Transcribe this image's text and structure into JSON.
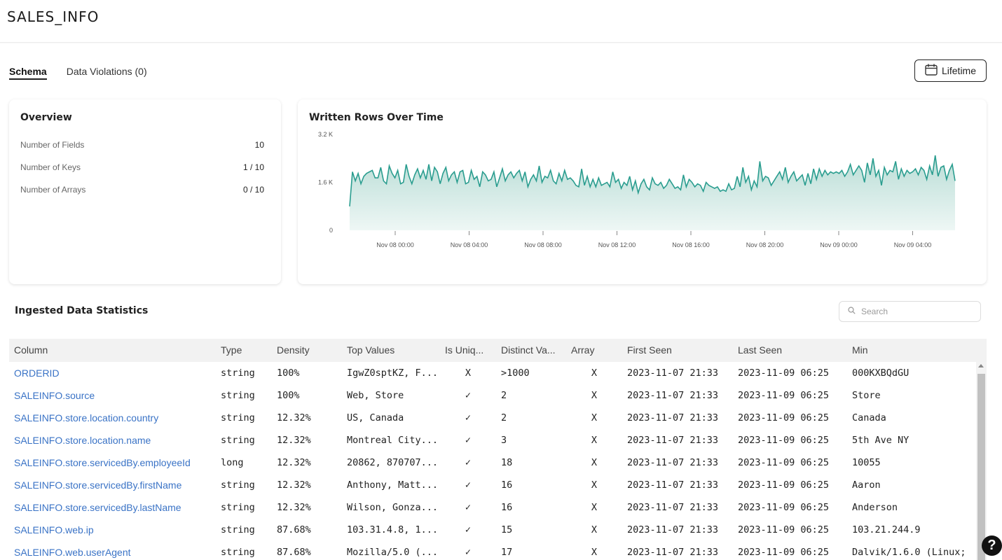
{
  "header": {
    "title": "SALES_INFO"
  },
  "tabs": [
    {
      "label": "Schema"
    },
    {
      "label": "Data Violations (0)"
    }
  ],
  "time_range": {
    "label": "Lifetime",
    "icon": "calendar-icon"
  },
  "overview": {
    "title": "Overview",
    "rows": [
      {
        "label": "Number of Fields",
        "value": "10"
      },
      {
        "label": "Number of Keys",
        "value": "1 / 10"
      },
      {
        "label": "Number of Arrays",
        "value": "0 / 10"
      }
    ]
  },
  "chart": {
    "title": "Written Rows Over Time"
  },
  "chart_data": {
    "type": "area",
    "title": "Written Rows Over Time",
    "y_ticks": [
      "3.2 K",
      "1.6 K",
      "0"
    ],
    "ylim": [
      0,
      3200
    ],
    "x_ticks": [
      "Nov 08 00:00",
      "Nov 08 04:00",
      "Nov 08 08:00",
      "Nov 08 12:00",
      "Nov 08 16:00",
      "Nov 08 20:00",
      "Nov 09 00:00",
      "Nov 09 04:00"
    ],
    "x_start": "2023-11-07 21:33",
    "x_end": "2023-11-09 06:25",
    "color": "#2a9d8f",
    "grid": false,
    "values": [
      800,
      1950,
      1650,
      1900,
      1550,
      1800,
      1900,
      1950,
      2000,
      1750,
      1750,
      2100,
      1650,
      1550,
      2150,
      1900,
      1750,
      2000,
      1550,
      1600,
      2200,
      1800,
      1550,
      1850,
      2050,
      1750,
      2000,
      1700,
      2200,
      1650,
      2100,
      1950,
      1550,
      1900,
      2100,
      1650,
      1850,
      1950,
      1600,
      1950,
      2000,
      1550,
      1600,
      2000,
      1700,
      1800,
      1450,
      1950,
      1850,
      1650,
      1700,
      1950,
      1450,
      1750,
      2050,
      1650,
      1850,
      1950,
      1750,
      1900,
      2000,
      1650,
      1950,
      1450,
      1700,
      1850,
      1650,
      2150,
      1600,
      1800,
      1750,
      2000,
      1650,
      1550,
      1900,
      1650,
      2000,
      1700,
      1750,
      1650,
      1500,
      1450,
      2050,
      1500,
      1800,
      1450,
      1700,
      1450,
      1750,
      1500,
      1550,
      1600,
      1450,
      1950,
      1600,
      1700,
      1400,
      1600,
      1500,
      1800,
      1350,
      1650,
      1250,
      1550,
      1700,
      1450,
      1350,
      1750,
      1550,
      1500,
      1600,
      1400,
      1500,
      1700,
      1550,
      1400,
      1450,
      1350,
      1850,
      1450,
      1700,
      1600,
      1450,
      1550,
      1500,
      1300,
      1600,
      1500,
      1450,
      1400,
      1450,
      1300,
      1350,
      1300,
      1550,
      1350,
      1400,
      1800,
      1450,
      2100,
      1600,
      1800,
      1350,
      1650,
      1450,
      2300,
      1650,
      1800,
      1750,
      1500,
      1650,
      1800,
      1950,
      1700,
      2100,
      1600,
      1800,
      1950,
      1650,
      1750,
      1850,
      1500,
      1900,
      1550,
      2050,
      1700,
      2050,
      1800,
      2000,
      1850,
      1950,
      1900,
      1950,
      1900,
      2000,
      1800,
      1950,
      2200,
      1850,
      2000,
      2150,
      2000,
      1600,
      2250,
      1850,
      2400,
      1800,
      2000,
      1500,
      2100,
      1850,
      2000,
      1950,
      2300,
      1700,
      2050,
      1800,
      2000,
      1900,
      1950,
      2050,
      1850,
      2100,
      2000,
      1700,
      2150,
      1850,
      2500,
      1800,
      2100,
      2150,
      1700,
      2000,
      2200,
      1650
    ]
  },
  "stats": {
    "title": "Ingested Data Statistics",
    "search_placeholder": "Search",
    "columns": [
      "Column",
      "Type",
      "Density",
      "Top Values",
      "Is Uniq...",
      "Distinct Va...",
      "Array",
      "First Seen",
      "Last Seen",
      "Min"
    ],
    "rows": [
      {
        "column": "ORDERID",
        "type": "string",
        "density": "100%",
        "top_values": "IgwZ0sptKZ, F...",
        "is_unique": "X",
        "distinct": ">1000",
        "array": "X",
        "first_seen": "2023-11-07 21:33",
        "last_seen": "2023-11-09 06:25",
        "min": "000KXBQdGU"
      },
      {
        "column": "SALEINFO.source",
        "type": "string",
        "density": "100%",
        "top_values": "Web, Store",
        "is_unique": "✓",
        "distinct": "2",
        "array": "X",
        "first_seen": "2023-11-07 21:33",
        "last_seen": "2023-11-09 06:25",
        "min": "Store"
      },
      {
        "column": "SALEINFO.store.location.country",
        "type": "string",
        "density": "12.32%",
        "top_values": "US, Canada",
        "is_unique": "✓",
        "distinct": "2",
        "array": "X",
        "first_seen": "2023-11-07 21:33",
        "last_seen": "2023-11-09 06:25",
        "min": "Canada"
      },
      {
        "column": "SALEINFO.store.location.name",
        "type": "string",
        "density": "12.32%",
        "top_values": "Montreal City...",
        "is_unique": "✓",
        "distinct": "3",
        "array": "X",
        "first_seen": "2023-11-07 21:33",
        "last_seen": "2023-11-09 06:25",
        "min": "5th Ave NY"
      },
      {
        "column": "SALEINFO.store.servicedBy.employeeId",
        "type": "long",
        "density": "12.32%",
        "top_values": "20862, 870707...",
        "is_unique": "✓",
        "distinct": "18",
        "array": "X",
        "first_seen": "2023-11-07 21:33",
        "last_seen": "2023-11-09 06:25",
        "min": "10055"
      },
      {
        "column": "SALEINFO.store.servicedBy.firstName",
        "type": "string",
        "density": "12.32%",
        "top_values": "Anthony, Matt...",
        "is_unique": "✓",
        "distinct": "16",
        "array": "X",
        "first_seen": "2023-11-07 21:33",
        "last_seen": "2023-11-09 06:25",
        "min": "Aaron"
      },
      {
        "column": "SALEINFO.store.servicedBy.lastName",
        "type": "string",
        "density": "12.32%",
        "top_values": "Wilson, Gonza...",
        "is_unique": "✓",
        "distinct": "16",
        "array": "X",
        "first_seen": "2023-11-07 21:33",
        "last_seen": "2023-11-09 06:25",
        "min": "Anderson"
      },
      {
        "column": "SALEINFO.web.ip",
        "type": "string",
        "density": "87.68%",
        "top_values": "103.31.4.8, 1...",
        "is_unique": "✓",
        "distinct": "15",
        "array": "X",
        "first_seen": "2023-11-07 21:33",
        "last_seen": "2023-11-09 06:25",
        "min": "103.21.244.9"
      },
      {
        "column": "SALEINFO.web.userAgent",
        "type": "string",
        "density": "87.68%",
        "top_values": "Mozilla/5.0 (...",
        "is_unique": "✓",
        "distinct": "17",
        "array": "X",
        "first_seen": "2023-11-07 21:33",
        "last_seen": "2023-11-09 06:25",
        "min": "Dalvik/1.6.0 (Linux;"
      }
    ]
  },
  "help": {
    "label": "?"
  }
}
